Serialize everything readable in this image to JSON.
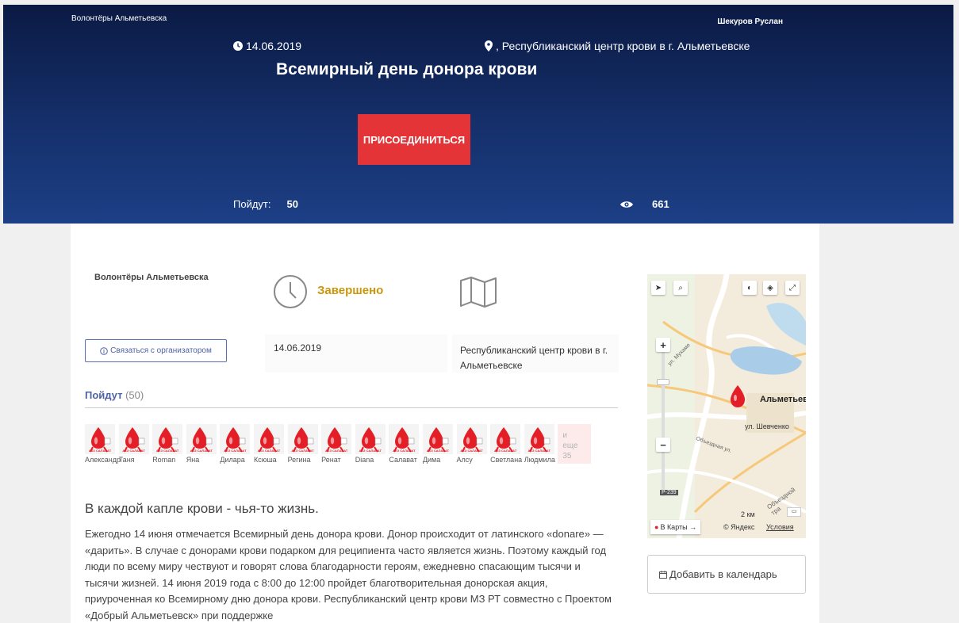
{
  "header": {
    "org_name": "Волонтёры Альметьевска",
    "user_name": "Шекуров Руслан",
    "date": "14.06.2019",
    "place": ", Республиканский центр крови в г. Альметьевске",
    "title": "Всемирный день донора крови",
    "join_label": "ПРИСОЕДИНИТЬСЯ",
    "going_label": "Пойдут:",
    "going_count": "50",
    "views_count": "661"
  },
  "colors": {
    "header_bg": "#15306b",
    "join_button": "#e53437",
    "status": "#c9960c",
    "accent": "#4e63a6"
  },
  "card": {
    "org_name": "Волонтёры Альметьевска",
    "status": "Завершено",
    "contact_label": "Связаться с организатором",
    "date": "14.06.2019",
    "place": "Республиканский центр крови в г. Альметьевске",
    "going_tab": "Пойдут",
    "going_tab_count": "(50)"
  },
  "avatar_logo_text": "АКЗ САЛАВАТ",
  "participants": [
    "Александр",
    "Таня",
    "Roman",
    "Яна",
    "Дилара",
    "Ксюша",
    "Регина",
    "Ренат",
    "Diana",
    "Салават",
    "Дима",
    "Алсу",
    "Светлана",
    "Людмила"
  ],
  "more": {
    "line1": "и",
    "line2": "еще",
    "count": "35"
  },
  "description": {
    "quote": "В каждой капле крови - чья-то жизнь.",
    "text": "Ежегодно 14 июня отмечается Всемирный день донора крови. Донор происходит от латинского «donare» — «дарить». В случае с донорами крови подарком для реципиента часто является жизнь. Поэтому каждый год люди по всему миру чествуют и говорят слова благодарности героям, ежедневно спасающим тысячи и тысячи жизней. 14 июня 2019 года с 8:00 до 12:00 пройдет благотворительная донорская акция, приуроченная ко Всемирному дню донора крови. Республиканский центр крови МЗ РТ совместно с Проектом «Добрый Альметьевск» при поддержке"
  },
  "map": {
    "city_label": "Альметьев",
    "street1": "ул. Шевченко",
    "street2": "Объездная ул.",
    "street3": "Объездной тра",
    "street4": "ул. Мухаме",
    "road": "Р-239",
    "scale": "2 км",
    "open_in_maps": "В Карты →",
    "copyright": "© Яндекс",
    "terms": "Условия",
    "zoom_in": "+",
    "zoom_out": "−"
  },
  "calendar_label": "Добавить в календарь"
}
